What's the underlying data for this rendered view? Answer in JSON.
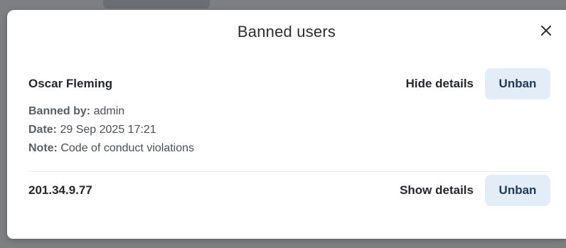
{
  "modal": {
    "title": "Banned users",
    "close_glyph": "×"
  },
  "bans": [
    {
      "name": "Oscar Fleming",
      "toggle_label": "Hide details",
      "unban_label": "Unban",
      "details": {
        "banned_by_label": "Banned by:",
        "banned_by": "admin",
        "date_label": "Date:",
        "date": "29 Sep 2025 17:21",
        "note_label": "Note:",
        "note": "Code of conduct violations"
      }
    },
    {
      "name": "201.34.9.77",
      "toggle_label": "Show details",
      "unban_label": "Unban"
    }
  ],
  "icons": {
    "close": "close-icon"
  },
  "colors": {
    "overlay": "#7d7f82",
    "unban_button_bg": "#e3edf7",
    "text_primary": "#24282c"
  }
}
